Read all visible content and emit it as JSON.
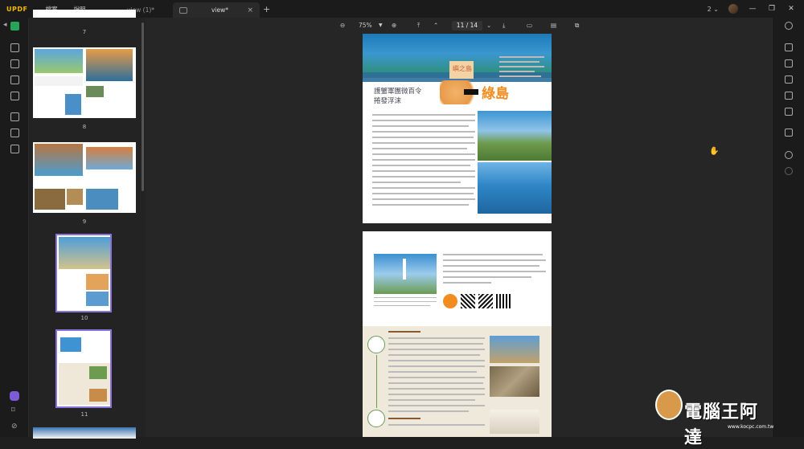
{
  "app": {
    "logo": "UPDF",
    "menu": [
      "檔案",
      "說明"
    ]
  },
  "tabs": [
    {
      "label": "view (1)*"
    },
    {
      "label": "view*"
    }
  ],
  "window": {
    "page_count_label": "2"
  },
  "toolbar": {
    "zoom": "75%",
    "current_page": "11",
    "total_pages": "/ 14"
  },
  "thumbnails": {
    "page_numbers": [
      "7",
      "8",
      "9",
      "10",
      "11"
    ]
  },
  "doc_page1": {
    "heading_small": "嶼之島",
    "heading_big": "綠島",
    "subtitle_line1": "護蟹軍團微百令",
    "subtitle_line2": "捲發浮沫"
  },
  "watermark": {
    "brand": "電腦王阿達",
    "url": "www.kocpc.com.tw"
  },
  "colors": {
    "accent_green": "#27a457",
    "selected_thumb": "#8a72d9",
    "orange": "#f28c1e"
  }
}
